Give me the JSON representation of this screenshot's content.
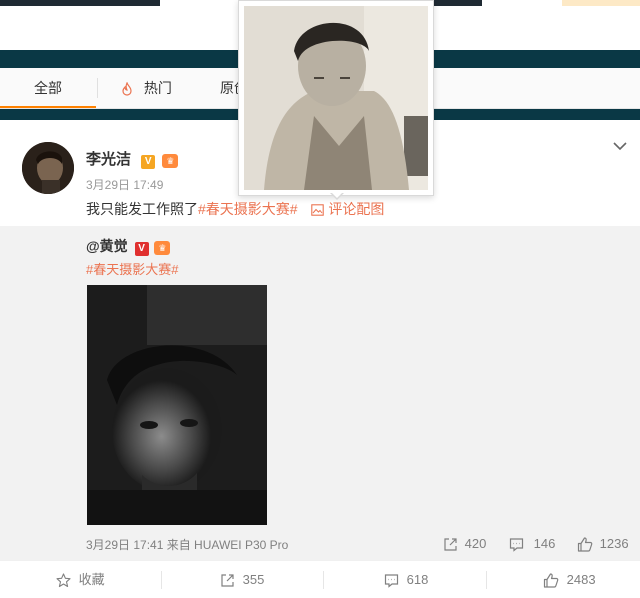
{
  "tabs": [
    {
      "label": "全部",
      "active": true
    },
    {
      "label": "热门",
      "icon": "flame-icon"
    },
    {
      "label": "原创"
    }
  ],
  "post": {
    "author": "李光洁",
    "time": "3月29日 17:49",
    "text": "我只能发工作照了",
    "hashtag": "#春天摄影大赛#",
    "comment_image_label": "评论配图"
  },
  "repost": {
    "author": "@黄觉",
    "hashtag": "#春天摄影大赛#",
    "time_source": "3月29日 17:41 来自 HUAWEI P30 Pro",
    "shares": "420",
    "comments": "146",
    "likes": "1236"
  },
  "footer": {
    "favorite_label": "收藏",
    "shares": "355",
    "comments": "618",
    "likes": "2483"
  },
  "colors": {
    "accent": "#ff8200",
    "hashtag": "#eb7350",
    "band": "#0a3845",
    "repost_bg": "#f2f2f2"
  }
}
